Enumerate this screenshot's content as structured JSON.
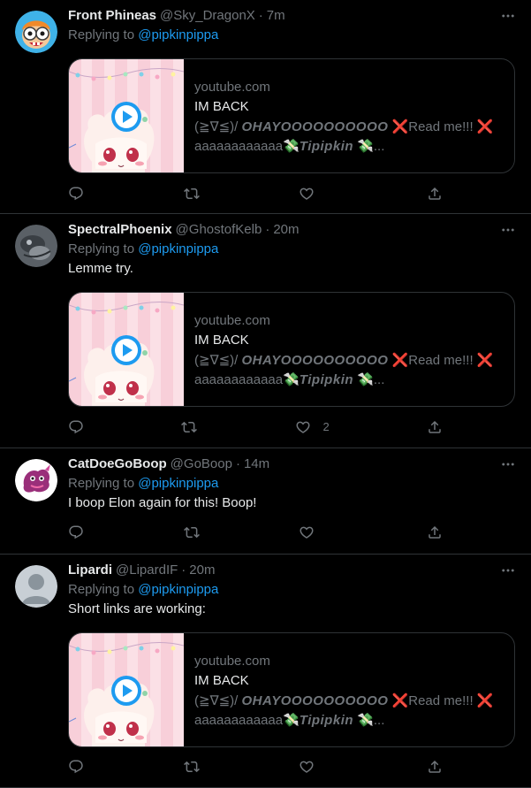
{
  "colors": {
    "background": "#000000",
    "text": "#e7e9ea",
    "muted": "#71767b",
    "mention": "#1d9bf0",
    "border": "#2f3336"
  },
  "tweets": [
    {
      "name": "Front Phineas",
      "handle": "@Sky_DragonX",
      "separator": "·",
      "time": "7m",
      "replying_prefix": "Replying to ",
      "replying_to": "@pipkinpippa",
      "text": "",
      "likes": "",
      "card": {
        "domain": "youtube.com",
        "title": "IM BACK",
        "desc_line1_prefix": "(≧∇≦)/ ",
        "desc_line1_bold": "OHAYOOOOOOOOOO",
        "desc_line1_suffix": " ❌Read me!!! ❌",
        "desc_line2_prefix": "aaaaaaaaaaaa💸",
        "desc_line2_bold": "Tipipkin",
        "desc_line2_suffix": " 💸..."
      }
    },
    {
      "name": "SpectralPhoenix",
      "handle": "@GhostofKelb",
      "separator": "·",
      "time": "20m",
      "replying_prefix": "Replying to ",
      "replying_to": "@pipkinpippa",
      "text": "Lemme try.",
      "likes": "2",
      "card": {
        "domain": "youtube.com",
        "title": "IM BACK",
        "desc_line1_prefix": "(≧∇≦)/ ",
        "desc_line1_bold": "OHAYOOOOOOOOOO",
        "desc_line1_suffix": " ❌Read me!!! ❌",
        "desc_line2_prefix": "aaaaaaaaaaaa💸",
        "desc_line2_bold": "Tipipkin",
        "desc_line2_suffix": " 💸..."
      }
    },
    {
      "name": "CatDoeGoBoop",
      "handle": "@GoBoop",
      "separator": "·",
      "time": "14m",
      "replying_prefix": "Replying to ",
      "replying_to": "@pipkinpippa",
      "text": "I boop Elon again for this! Boop!",
      "likes": ""
    },
    {
      "name": "Lipardi",
      "handle": "@LipardIF",
      "separator": "·",
      "time": "20m",
      "replying_prefix": "Replying to ",
      "replying_to": "@pipkinpippa",
      "text": "Short links are working:",
      "likes": "",
      "card": {
        "domain": "youtube.com",
        "title": "IM BACK",
        "desc_line1_prefix": "(≧∇≦)/ ",
        "desc_line1_bold": "OHAYOOOOOOOOOO",
        "desc_line1_suffix": " ❌Read me!!! ❌",
        "desc_line2_prefix": "aaaaaaaaaaaa💸",
        "desc_line2_bold": "Tipipkin",
        "desc_line2_suffix": " 💸..."
      }
    }
  ],
  "icons": {
    "reply": "reply-icon",
    "retweet": "retweet-icon",
    "like": "heart-icon",
    "share": "share-icon",
    "more": "more-icon",
    "play": "play-icon"
  }
}
